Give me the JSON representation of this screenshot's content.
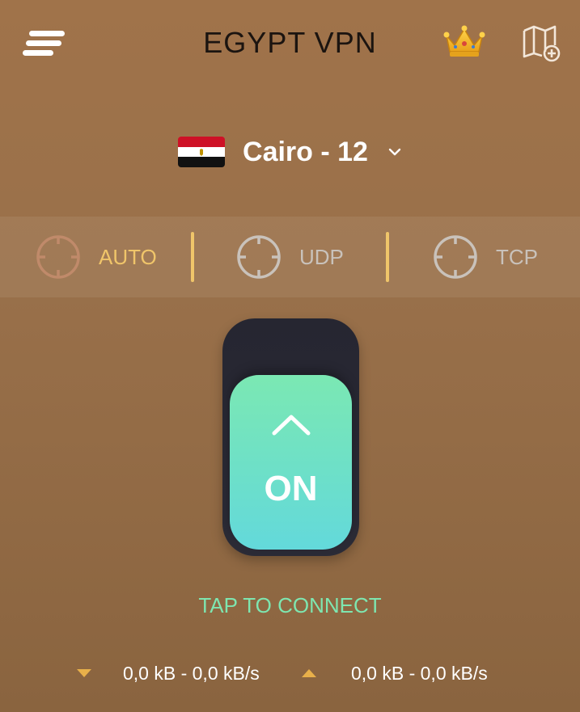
{
  "header": {
    "title": "EGYPT VPN",
    "menu_icon": "menu-icon",
    "premium_icon": "crown-icon",
    "map_icon": "map-add-icon"
  },
  "server": {
    "country_flag": "egypt-flag",
    "name": "Cairo - 12",
    "dropdown_icon": "chevron-down-icon"
  },
  "protocols": [
    {
      "label": "AUTO",
      "selected": true,
      "icon": "crosshair-icon"
    },
    {
      "label": "UDP",
      "selected": false,
      "icon": "crosshair-icon"
    },
    {
      "label": "TCP",
      "selected": false,
      "icon": "crosshair-icon"
    }
  ],
  "toggle": {
    "label": "ON",
    "arrow_icon": "chevron-up-icon"
  },
  "status": {
    "text": "TAP TO CONNECT"
  },
  "traffic": {
    "download": "0,0 kB - 0,0 kB/s",
    "upload": "0,0 kB - 0,0 kB/s"
  },
  "colors": {
    "accent_gold": "#f0c56a",
    "connect_green": "#7ee6b0",
    "protocol_inactive": "#c9c2bb",
    "auto_icon": "#c08a6a"
  }
}
